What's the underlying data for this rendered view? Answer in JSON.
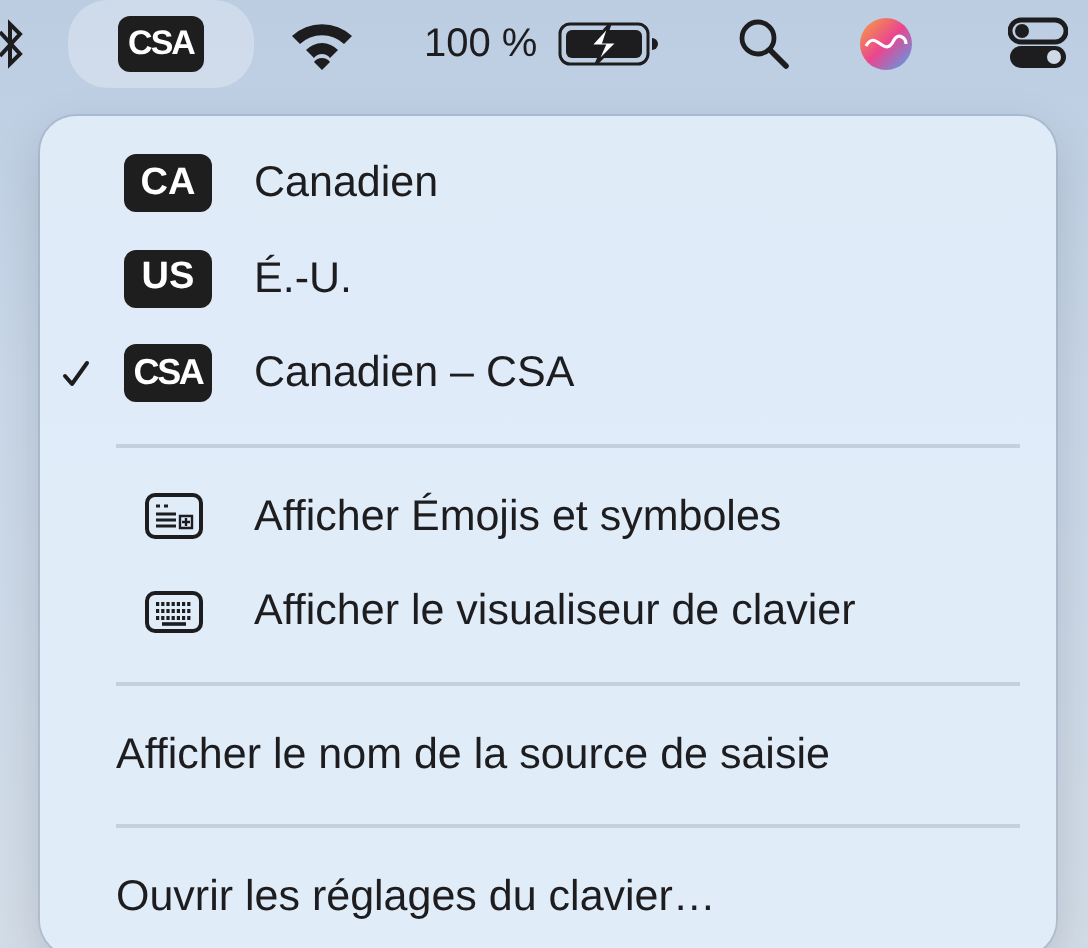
{
  "menu_bar": {
    "input_source": {
      "label": "CSA",
      "selected": true
    },
    "battery_percent": "100 %"
  },
  "menu": {
    "input_sources": [
      {
        "badge": "CA",
        "label": "Canadien",
        "checked": false
      },
      {
        "badge": "US",
        "label": "É.-U.",
        "checked": false
      },
      {
        "badge": "CSA",
        "label": "Canadien – CSA",
        "checked": true
      }
    ],
    "sections": [
      [
        {
          "kind": "emoji",
          "label": "Afficher Émojis et symboles"
        },
        {
          "kind": "keyboard",
          "label": "Afficher le visualiseur de clavier"
        }
      ],
      [
        {
          "kind": "plain",
          "label": "Afficher le nom de la source de saisie"
        }
      ],
      [
        {
          "kind": "plain",
          "label": "Ouvrir les réglages du clavier…"
        }
      ]
    ]
  }
}
